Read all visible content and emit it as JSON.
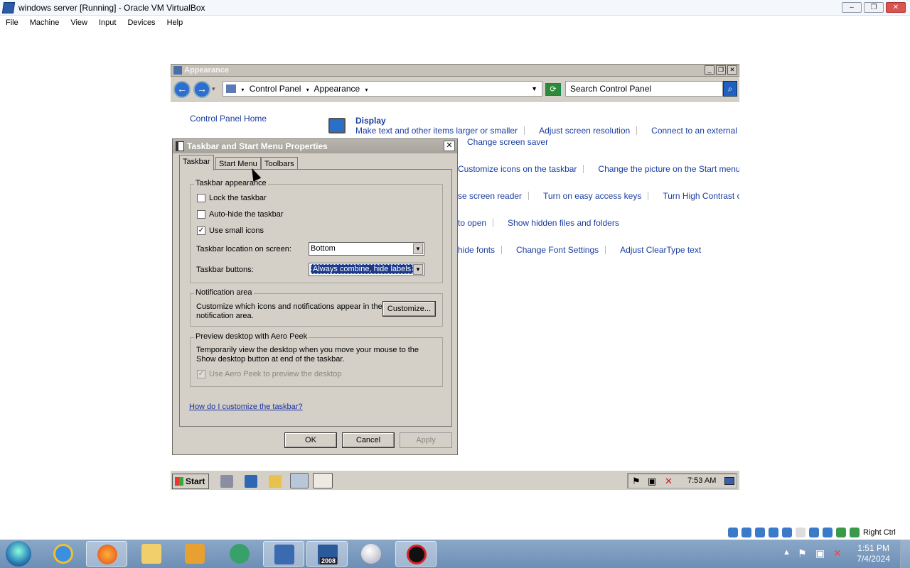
{
  "vbox": {
    "title": "windows server [Running] - Oracle VM VirtualBox",
    "menu": [
      "File",
      "Machine",
      "View",
      "Input",
      "Devices",
      "Help"
    ],
    "host_key": "Right Ctrl"
  },
  "cp": {
    "title": "Appearance",
    "breadcrumb": [
      "Control Panel",
      "Appearance"
    ],
    "search_placeholder": "Search Control Panel",
    "home": "Control Panel Home",
    "display_heading": "Display",
    "display_links": [
      "Make text and other items larger or smaller",
      "Adjust screen resolution",
      "Connect to an external display"
    ],
    "row_screensaver": "Change screen saver",
    "row_taskbar": [
      "Customize icons on the taskbar",
      "Change the picture on the Start menu"
    ],
    "row_access": [
      "se screen reader",
      "Turn on easy access keys",
      "Turn High Contrast on or off"
    ],
    "row_folder": [
      "to open",
      "Show hidden files and folders"
    ],
    "row_fonts": [
      "hide fonts",
      "Change Font Settings",
      "Adjust ClearType text"
    ]
  },
  "dialog": {
    "title": "Taskbar and Start Menu Properties",
    "tabs": [
      "Taskbar",
      "Start Menu",
      "Toolbars"
    ],
    "appearance_group": "Taskbar appearance",
    "lock": "Lock the taskbar",
    "autohide": "Auto-hide the taskbar",
    "small_icons": "Use small icons",
    "location_label": "Taskbar location on screen:",
    "location_value": "Bottom",
    "buttons_label": "Taskbar buttons:",
    "buttons_value": "Always combine, hide labels",
    "notif_group": "Notification area",
    "notif_text": "Customize which icons and notifications appear in the notification area.",
    "customize_btn": "Customize...",
    "peek_group": "Preview desktop with Aero Peek",
    "peek_text": "Temporarily view the desktop when you move your mouse to the Show desktop button at end of the taskbar.",
    "peek_check": "Use Aero Peek to preview the desktop",
    "help_link": "How do I customize the taskbar?",
    "ok": "OK",
    "cancel": "Cancel",
    "apply": "Apply",
    "lock_checked": false,
    "autohide_checked": false,
    "small_icons_checked": true
  },
  "guest_taskbar": {
    "start": "Start",
    "time": "7:53 AM"
  },
  "host_taskbar": {
    "time": "1:51 PM",
    "date": "7/4/2024",
    "badge": "2008"
  }
}
